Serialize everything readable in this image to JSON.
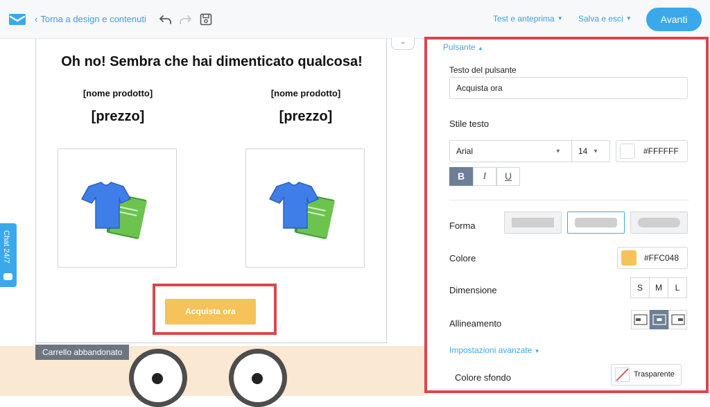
{
  "topbar": {
    "back_label": "Torna a design e contenuti",
    "back_chevron": "‹",
    "test_menu": "Test e anteprima",
    "save_menu": "Salva e esci",
    "next_button": "Avanti",
    "icons": [
      "logo-icon",
      "undo-icon",
      "redo-icon",
      "save-icon"
    ]
  },
  "email": {
    "heading": "Oh no! Sembra che hai dimenticato qualcosa!",
    "products": [
      {
        "name": "[nome prodotto]",
        "price": "[prezzo]",
        "image": "tshirt-book-icon"
      },
      {
        "name": "[nome prodotto]",
        "price": "[prezzo]",
        "image": "tshirt-book-icon"
      }
    ],
    "button_label": "Acquista ora",
    "template_tag": "Carrello abbandonato"
  },
  "chat": {
    "label": "Chat 24/7"
  },
  "panel": {
    "section_title": "Pulsante",
    "button_text_label": "Testo del pulsante",
    "button_text_value": "Acquista ora",
    "text_style_label": "Stile testo",
    "font_family": "Arial",
    "font_size": "14",
    "text_color_hex": "#FFFFFF",
    "style_buttons": [
      "B",
      "I",
      "U"
    ],
    "shape_label": "Forma",
    "color_label": "Colore",
    "button_color_hex": "#FFC048",
    "size_label": "Dimensione",
    "sizes": [
      "S",
      "M",
      "L"
    ],
    "alignment_label": "Allineamento",
    "advanced_link": "Impostazioni avanzate",
    "bg_color_label": "Colore sfondo",
    "bg_color_value": "Trasparente"
  },
  "colors": {
    "accent": "#3AA9EC",
    "button_fill": "#F5C35A",
    "highlight_border": "#D9474C"
  }
}
